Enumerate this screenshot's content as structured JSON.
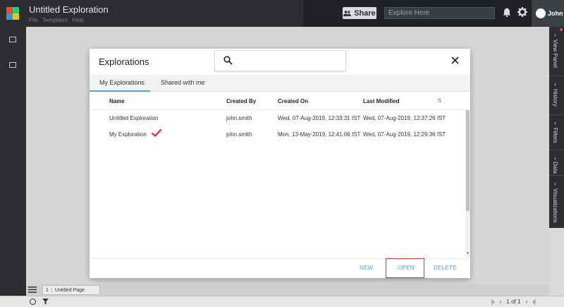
{
  "app": {
    "title": "Untitled Exploration",
    "menu": [
      "File",
      "Templates",
      "Help"
    ],
    "share_label": "Share",
    "explore_placeholder": "Explore Here",
    "user_name": "John"
  },
  "right_panel": {
    "items": [
      "View Panel",
      "History",
      "Filters",
      "Data",
      "Visualizations"
    ]
  },
  "bottom": {
    "page_number": "1",
    "page_name": "Untitled Page",
    "pager_text": "1 of 1"
  },
  "modal": {
    "title": "Explorations",
    "search_placeholder": "",
    "tabs": [
      {
        "label": "My Explorations",
        "active": true
      },
      {
        "label": "Shared with me",
        "active": false
      }
    ],
    "columns": [
      "Name",
      "Created By",
      "Created On",
      "Last Modified"
    ],
    "rows": [
      {
        "name": "Untitled Exploration",
        "created_by": "john.smith",
        "created_on": "Wed, 07-Aug-2019, 12:33:31 IST",
        "last_modified": "Wed, 07-Aug-2019, 12:37:26 IST",
        "checked": false
      },
      {
        "name": "My Exploration",
        "created_by": "john.smith",
        "created_on": "Mon, 13-May-2019, 12:41:06 IST",
        "last_modified": "Wed, 07-Aug-2019, 12:29:36 IST",
        "checked": true
      }
    ],
    "buttons": {
      "new": "NEW",
      "open": "OPEN",
      "delete": "DELETE"
    }
  },
  "colors": {
    "accent": "#4a9ede",
    "highlight_frame": "#d32f2f",
    "check": "#e53935",
    "topbar": "#2b2d30"
  }
}
